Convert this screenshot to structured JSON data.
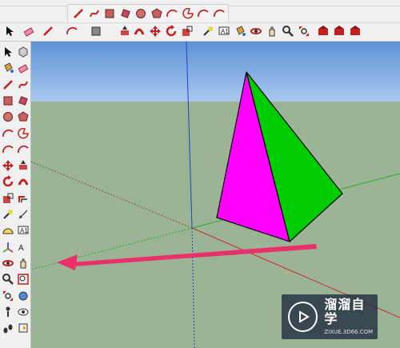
{
  "toolbars": {
    "top_row1": [
      "pencil-icon",
      "freehand-icon",
      "rectangle-icon",
      "rotated-rectangle-icon",
      "circle-icon",
      "polygon-icon",
      "arc-icon",
      "pie-icon",
      "two-point-arc-icon",
      "three-point-arc-icon"
    ],
    "top_row2": [
      "select-icon",
      "eraser-icon",
      "line-icon",
      "arc-icon",
      "shape-icon",
      "push-pull-icon",
      "follow-me-icon",
      "move-icon",
      "rotate-icon",
      "scale-icon",
      "tape-measure-icon",
      "text-icon",
      "paint-bucket-icon",
      "orbit-icon",
      "pan-icon",
      "zoom-icon",
      "zoom-extents-icon",
      "warehouse-icon",
      "extension-warehouse-icon",
      "layout-icon"
    ],
    "left": [
      "select-icon",
      "make-component-icon",
      "paint-bucket-icon",
      "eraser-icon",
      "line-icon",
      "freehand-icon",
      "rectangle-icon",
      "rotated-rectangle-icon",
      "circle-icon",
      "polygon-icon",
      "arc-icon",
      "pie-icon",
      "three-point-arc-icon",
      "two-point-arc-icon",
      "move-icon",
      "push-pull-icon",
      "rotate-icon",
      "follow-me-icon",
      "scale-icon",
      "offset-icon",
      "tape-measure-icon",
      "dimension-icon",
      "protractor-icon",
      "text-icon",
      "axes-icon",
      "3d-text-icon",
      "orbit-icon",
      "pan-icon",
      "zoom-icon",
      "zoom-window-icon",
      "zoom-extents-icon",
      "previous-view-icon",
      "position-camera-icon",
      "look-around-icon",
      "walk-icon",
      "section-plane-icon"
    ]
  },
  "colors": {
    "sky": "#77a7dc",
    "ground": "#9cb496",
    "pyramid_left": "#ff00ff",
    "pyramid_right": "#00cc00",
    "arrow": "#e8306a",
    "axis_red": "#cc2a2a",
    "axis_green": "#2aa82a",
    "axis_blue": "#2040c8"
  },
  "watermark": {
    "title": "溜溜自学",
    "url": "ZIXUE.3D66.COM"
  }
}
